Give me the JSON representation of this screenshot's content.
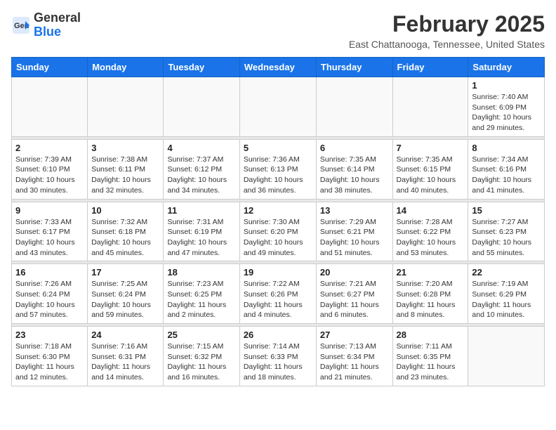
{
  "header": {
    "logo_line1": "General",
    "logo_line2": "Blue",
    "title": "February 2025",
    "subtitle": "East Chattanooga, Tennessee, United States"
  },
  "weekdays": [
    "Sunday",
    "Monday",
    "Tuesday",
    "Wednesday",
    "Thursday",
    "Friday",
    "Saturday"
  ],
  "weeks": [
    [
      {
        "day": "",
        "info": ""
      },
      {
        "day": "",
        "info": ""
      },
      {
        "day": "",
        "info": ""
      },
      {
        "day": "",
        "info": ""
      },
      {
        "day": "",
        "info": ""
      },
      {
        "day": "",
        "info": ""
      },
      {
        "day": "1",
        "info": "Sunrise: 7:40 AM\nSunset: 6:09 PM\nDaylight: 10 hours and 29 minutes."
      }
    ],
    [
      {
        "day": "2",
        "info": "Sunrise: 7:39 AM\nSunset: 6:10 PM\nDaylight: 10 hours and 30 minutes."
      },
      {
        "day": "3",
        "info": "Sunrise: 7:38 AM\nSunset: 6:11 PM\nDaylight: 10 hours and 32 minutes."
      },
      {
        "day": "4",
        "info": "Sunrise: 7:37 AM\nSunset: 6:12 PM\nDaylight: 10 hours and 34 minutes."
      },
      {
        "day": "5",
        "info": "Sunrise: 7:36 AM\nSunset: 6:13 PM\nDaylight: 10 hours and 36 minutes."
      },
      {
        "day": "6",
        "info": "Sunrise: 7:35 AM\nSunset: 6:14 PM\nDaylight: 10 hours and 38 minutes."
      },
      {
        "day": "7",
        "info": "Sunrise: 7:35 AM\nSunset: 6:15 PM\nDaylight: 10 hours and 40 minutes."
      },
      {
        "day": "8",
        "info": "Sunrise: 7:34 AM\nSunset: 6:16 PM\nDaylight: 10 hours and 41 minutes."
      }
    ],
    [
      {
        "day": "9",
        "info": "Sunrise: 7:33 AM\nSunset: 6:17 PM\nDaylight: 10 hours and 43 minutes."
      },
      {
        "day": "10",
        "info": "Sunrise: 7:32 AM\nSunset: 6:18 PM\nDaylight: 10 hours and 45 minutes."
      },
      {
        "day": "11",
        "info": "Sunrise: 7:31 AM\nSunset: 6:19 PM\nDaylight: 10 hours and 47 minutes."
      },
      {
        "day": "12",
        "info": "Sunrise: 7:30 AM\nSunset: 6:20 PM\nDaylight: 10 hours and 49 minutes."
      },
      {
        "day": "13",
        "info": "Sunrise: 7:29 AM\nSunset: 6:21 PM\nDaylight: 10 hours and 51 minutes."
      },
      {
        "day": "14",
        "info": "Sunrise: 7:28 AM\nSunset: 6:22 PM\nDaylight: 10 hours and 53 minutes."
      },
      {
        "day": "15",
        "info": "Sunrise: 7:27 AM\nSunset: 6:23 PM\nDaylight: 10 hours and 55 minutes."
      }
    ],
    [
      {
        "day": "16",
        "info": "Sunrise: 7:26 AM\nSunset: 6:24 PM\nDaylight: 10 hours and 57 minutes."
      },
      {
        "day": "17",
        "info": "Sunrise: 7:25 AM\nSunset: 6:24 PM\nDaylight: 10 hours and 59 minutes."
      },
      {
        "day": "18",
        "info": "Sunrise: 7:23 AM\nSunset: 6:25 PM\nDaylight: 11 hours and 2 minutes."
      },
      {
        "day": "19",
        "info": "Sunrise: 7:22 AM\nSunset: 6:26 PM\nDaylight: 11 hours and 4 minutes."
      },
      {
        "day": "20",
        "info": "Sunrise: 7:21 AM\nSunset: 6:27 PM\nDaylight: 11 hours and 6 minutes."
      },
      {
        "day": "21",
        "info": "Sunrise: 7:20 AM\nSunset: 6:28 PM\nDaylight: 11 hours and 8 minutes."
      },
      {
        "day": "22",
        "info": "Sunrise: 7:19 AM\nSunset: 6:29 PM\nDaylight: 11 hours and 10 minutes."
      }
    ],
    [
      {
        "day": "23",
        "info": "Sunrise: 7:18 AM\nSunset: 6:30 PM\nDaylight: 11 hours and 12 minutes."
      },
      {
        "day": "24",
        "info": "Sunrise: 7:16 AM\nSunset: 6:31 PM\nDaylight: 11 hours and 14 minutes."
      },
      {
        "day": "25",
        "info": "Sunrise: 7:15 AM\nSunset: 6:32 PM\nDaylight: 11 hours and 16 minutes."
      },
      {
        "day": "26",
        "info": "Sunrise: 7:14 AM\nSunset: 6:33 PM\nDaylight: 11 hours and 18 minutes."
      },
      {
        "day": "27",
        "info": "Sunrise: 7:13 AM\nSunset: 6:34 PM\nDaylight: 11 hours and 21 minutes."
      },
      {
        "day": "28",
        "info": "Sunrise: 7:11 AM\nSunset: 6:35 PM\nDaylight: 11 hours and 23 minutes."
      },
      {
        "day": "",
        "info": ""
      }
    ]
  ]
}
